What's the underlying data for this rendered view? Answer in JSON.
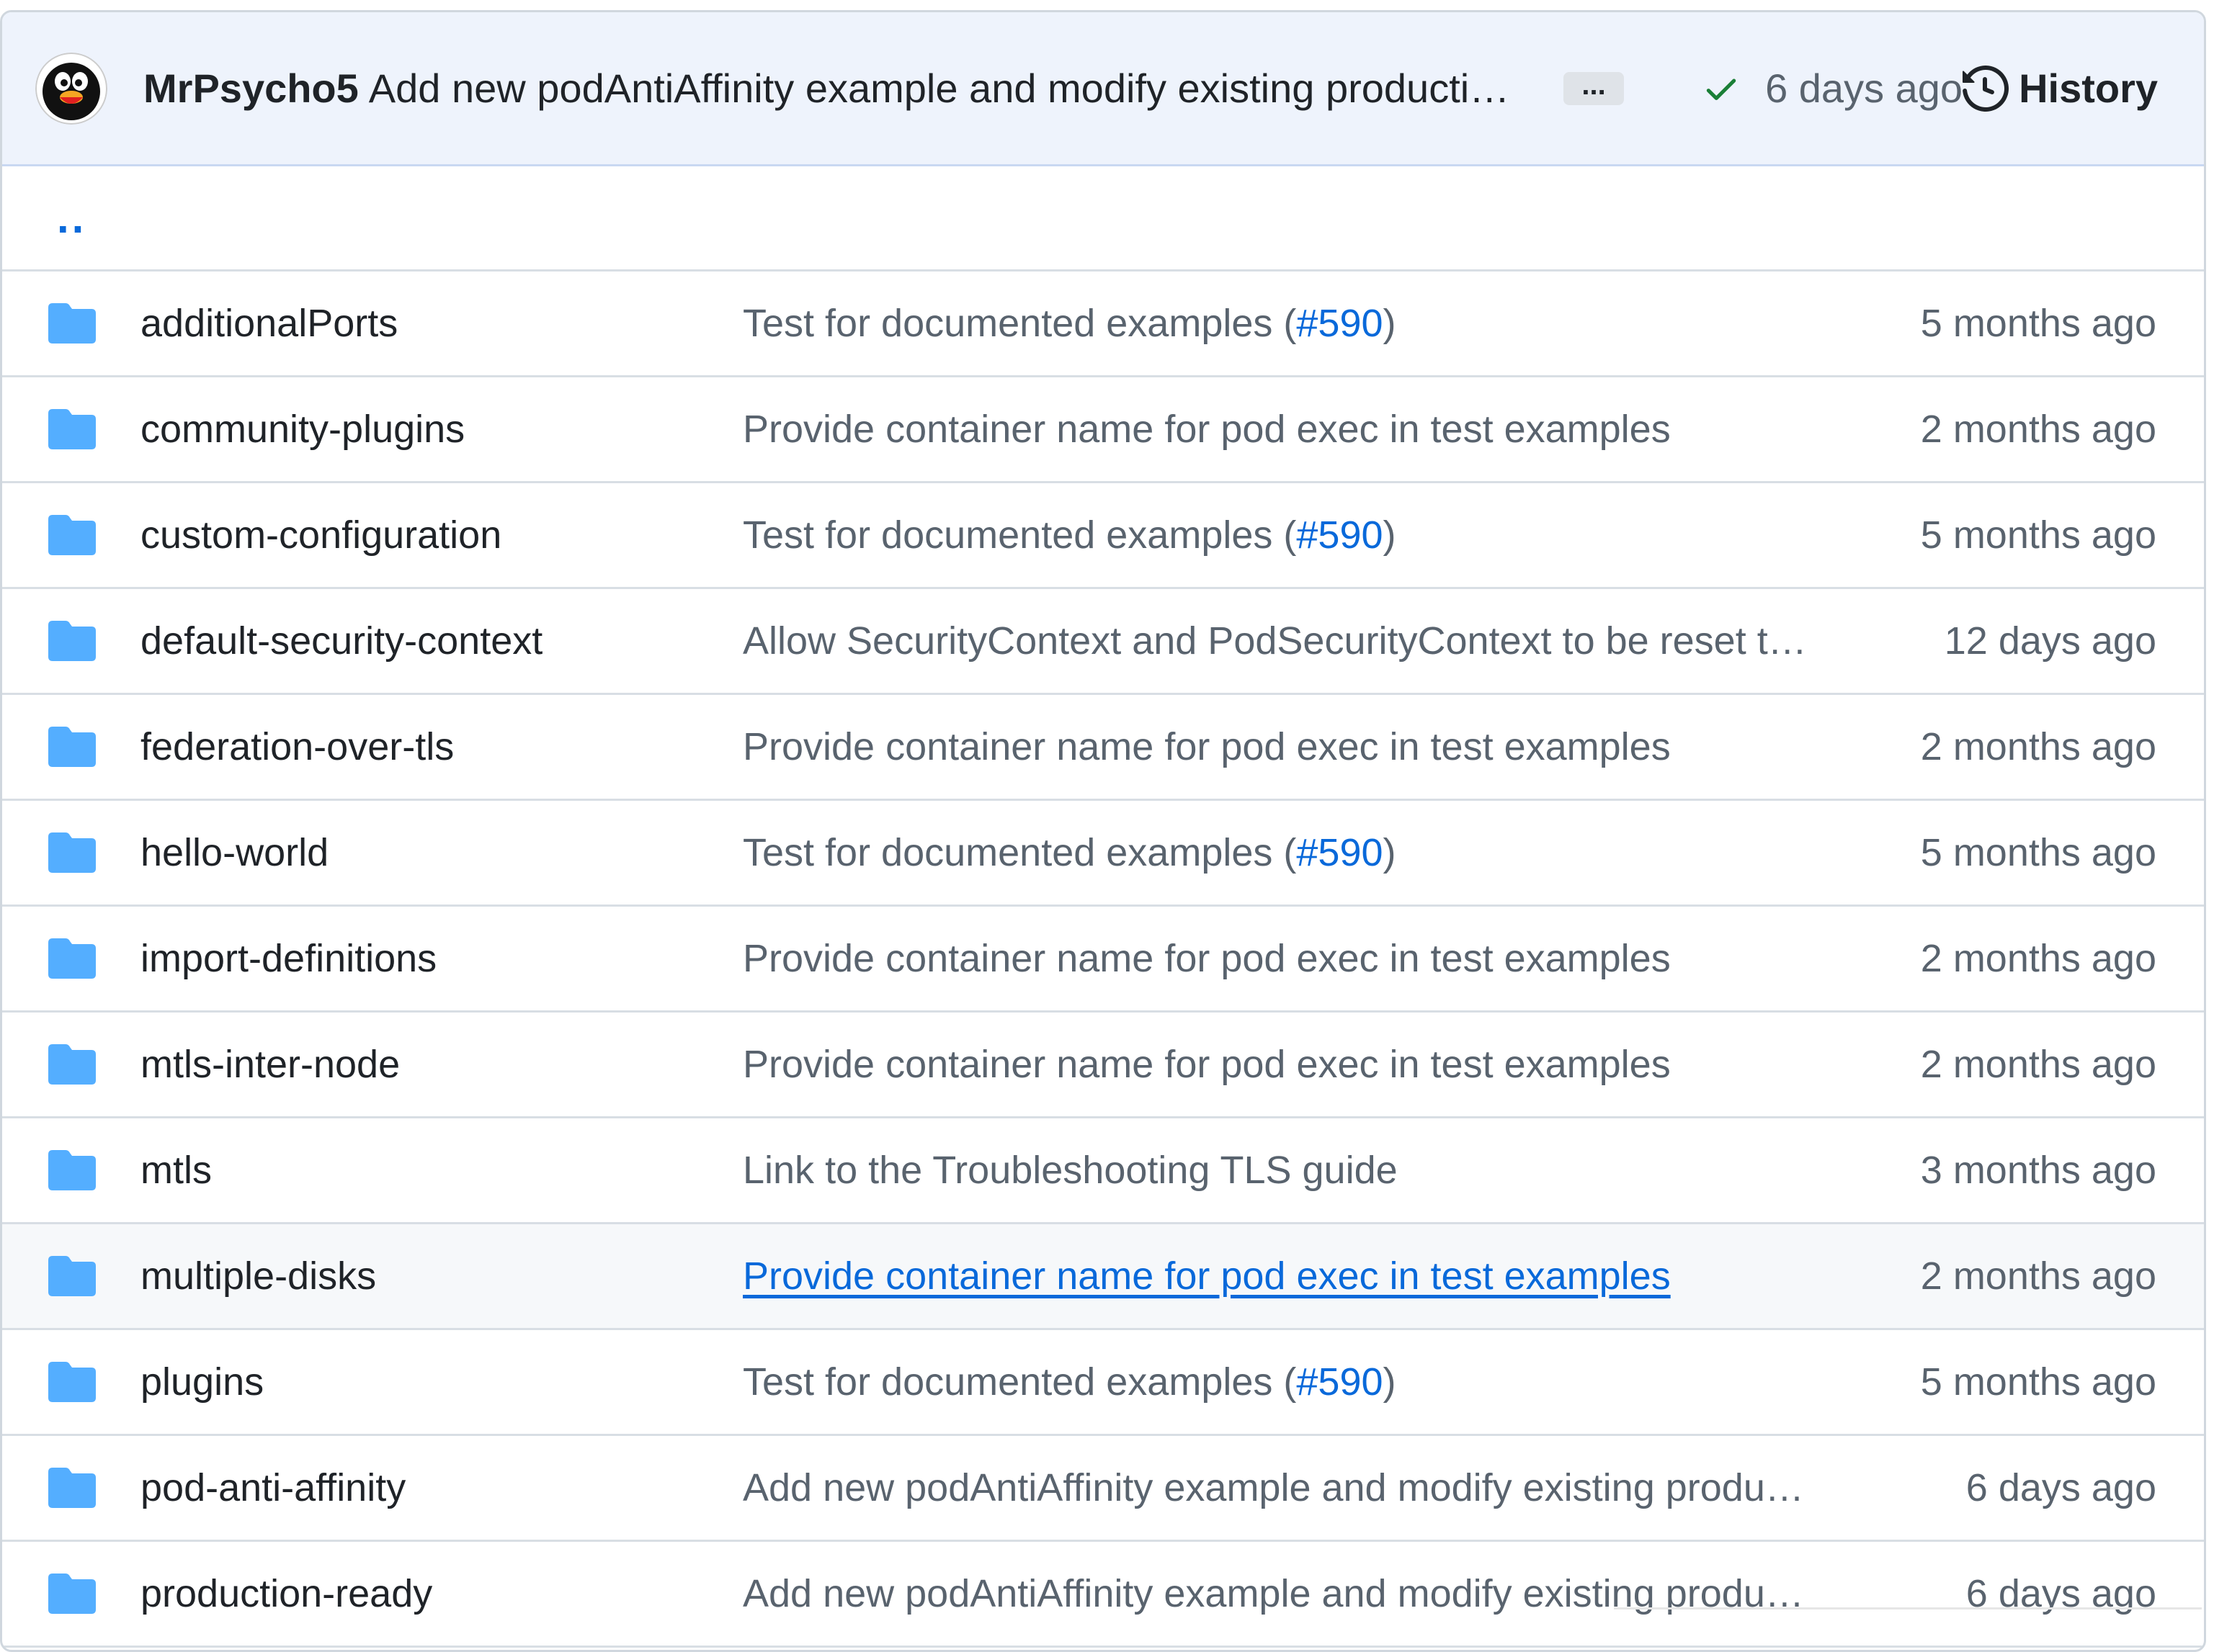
{
  "commit": {
    "author": "MrPsycho5",
    "message": "Add new podAntiAffinity example and modify existing production…",
    "more_label": "...",
    "status_icon": "check-icon",
    "time": "6 days ago",
    "history_label": "History"
  },
  "parent_dir": "..",
  "files": [
    {
      "name": "additionalPorts",
      "message": "Test for documented examples (",
      "pr": "#590",
      "message_end": ")",
      "age": "5 months ago",
      "hover": false
    },
    {
      "name": "community-plugins",
      "message": "Provide container name for pod exec in test examples",
      "pr": "",
      "message_end": "",
      "age": "2 months ago",
      "hover": false
    },
    {
      "name": "custom-configuration",
      "message": "Test for documented examples (",
      "pr": "#590",
      "message_end": ")",
      "age": "5 months ago",
      "hover": false
    },
    {
      "name": "default-security-context",
      "message": "Allow SecurityContext and PodSecurityContext to be reset t…",
      "pr": "",
      "message_end": "",
      "age": "12 days ago",
      "hover": false
    },
    {
      "name": "federation-over-tls",
      "message": "Provide container name for pod exec in test examples",
      "pr": "",
      "message_end": "",
      "age": "2 months ago",
      "hover": false
    },
    {
      "name": "hello-world",
      "message": "Test for documented examples (",
      "pr": "#590",
      "message_end": ")",
      "age": "5 months ago",
      "hover": false
    },
    {
      "name": "import-definitions",
      "message": "Provide container name for pod exec in test examples",
      "pr": "",
      "message_end": "",
      "age": "2 months ago",
      "hover": false
    },
    {
      "name": "mtls-inter-node",
      "message": "Provide container name for pod exec in test examples",
      "pr": "",
      "message_end": "",
      "age": "2 months ago",
      "hover": false
    },
    {
      "name": "mtls",
      "message": "Link to the Troubleshooting TLS guide",
      "pr": "",
      "message_end": "",
      "age": "3 months ago",
      "hover": false
    },
    {
      "name": "multiple-disks",
      "message": "Provide container name for pod exec in test examples",
      "pr": "",
      "message_end": "",
      "age": "2 months ago",
      "hover": true
    },
    {
      "name": "plugins",
      "message": "Test for documented examples (",
      "pr": "#590",
      "message_end": ")",
      "age": "5 months ago",
      "hover": false
    },
    {
      "name": "pod-anti-affinity",
      "message": "Add new podAntiAffinity example and modify existing produ…",
      "pr": "",
      "message_end": "",
      "age": "6 days ago",
      "hover": false
    },
    {
      "name": "production-ready",
      "message": "Add new podAntiAffinity example and modify existing produ…",
      "pr": "",
      "message_end": "",
      "age": "6 days ago",
      "hover": false
    }
  ],
  "colors": {
    "link": "#0969da",
    "folder": "#54aeff",
    "check": "#1a7f37",
    "header_bg": "#eef3fc"
  }
}
